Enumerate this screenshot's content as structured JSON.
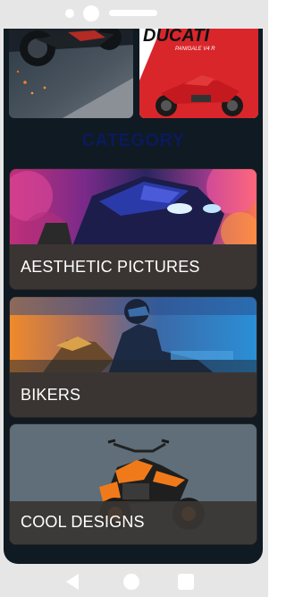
{
  "main": {
    "section_title": "CATEGORY",
    "top_wallpapers": [
      {
        "icon": "motorcycle-night-wallpaper"
      },
      {
        "icon": "ducati-panigale-wallpaper",
        "logo_text": "DUCATI",
        "model_text": "PANIGALE V4 R"
      }
    ],
    "categories": [
      {
        "label": "AESTHETIC PICTURES",
        "icon": "purple-sportbike-image"
      },
      {
        "label": "BIKERS",
        "icon": "biker-sunset-image"
      },
      {
        "label": "COOL DESIGNS",
        "icon": "orange-naked-bike-image"
      }
    ]
  },
  "navigation": {
    "icons": [
      "back-icon",
      "home-icon",
      "recents-icon"
    ]
  },
  "colors": {
    "screen_background": "#0f1a23",
    "section_title": "#0b1a5c",
    "card_label_bar": "#3a3533",
    "card_label_text": "#ffffff",
    "frame": "#e6e6e6"
  }
}
